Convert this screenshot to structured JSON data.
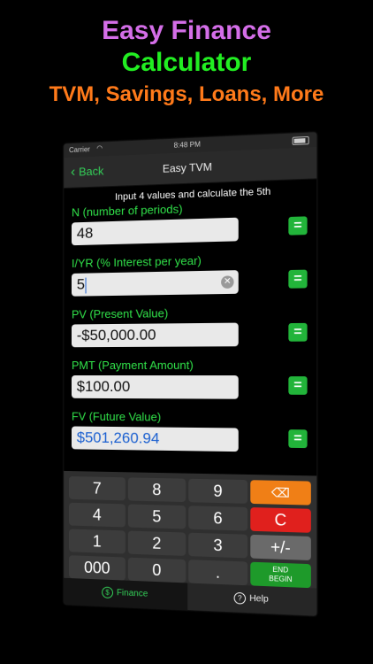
{
  "headline": {
    "line1": "Easy Finance",
    "line2": "Calculator",
    "line3": "TVM, Savings, Loans, More"
  },
  "status_bar": {
    "carrier": "Carrier",
    "time": "8:48 PM"
  },
  "nav": {
    "back_label": "Back",
    "title": "Easy TVM"
  },
  "instruction": "Input 4 values and calculate the 5th",
  "fields": [
    {
      "label": "N (number of periods)",
      "value": "48"
    },
    {
      "label": "I/YR  (% Interest per year)",
      "value": "5"
    },
    {
      "label": "PV  (Present Value)",
      "value": "-$50,000.00"
    },
    {
      "label": "PMT  (Payment Amount)",
      "value": "$100.00"
    },
    {
      "label": "FV  (Future Value)",
      "value": "$501,260.94"
    }
  ],
  "equals_label": "=",
  "keypad": {
    "k7": "7",
    "k8": "8",
    "k9": "9",
    "del": "⌫",
    "k4": "4",
    "k5": "5",
    "k6": "6",
    "clear": "C",
    "k1": "1",
    "k2": "2",
    "k3": "3",
    "plusminus": "+/-",
    "k000": "000",
    "k0": "0",
    "dot": ".",
    "end": "END",
    "begin": "BEGIN"
  },
  "tabs": {
    "finance": "Finance",
    "help": "Help"
  },
  "colors": {
    "accent": "#31e34a",
    "delete": "#f07f16",
    "clear": "#e0201d",
    "end": "#1e9a2a"
  }
}
